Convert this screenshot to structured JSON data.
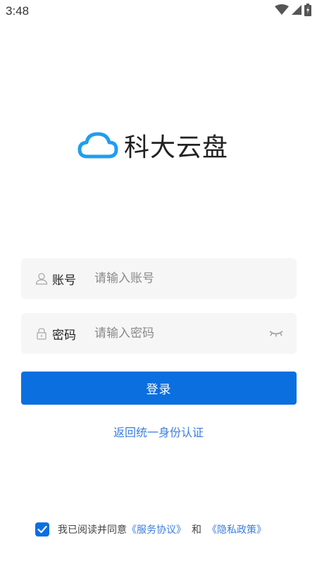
{
  "status_bar": {
    "time": "3:48",
    "icons": [
      "wifi-icon",
      "signal-icon",
      "battery-icon"
    ]
  },
  "app": {
    "name": "科大云盘",
    "logo_icon": "cloud-icon",
    "accent_color": "#0b6fe0"
  },
  "form": {
    "account": {
      "icon": "user-icon",
      "label": "账号",
      "value": "",
      "placeholder": "请输入账号"
    },
    "password": {
      "icon": "lock-icon",
      "label": "密码",
      "value": "",
      "placeholder": "请输入密码",
      "toggle_icon": "eye-closed-icon"
    },
    "login_label": "登录",
    "sso_link": "返回统一身份认证"
  },
  "agreement": {
    "checked": true,
    "prefix": "我已阅读并同意",
    "service_link": "《服务协议》",
    "conjunction": "和",
    "privacy_link": "《隐私政策》"
  }
}
